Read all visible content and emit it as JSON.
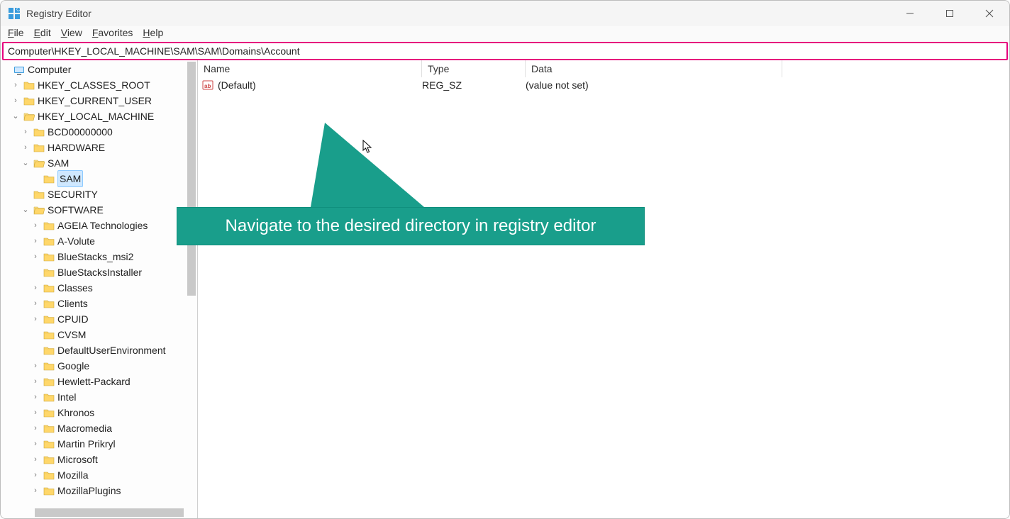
{
  "window": {
    "title": "Registry Editor"
  },
  "menu": {
    "file": "File",
    "edit": "Edit",
    "view": "View",
    "favorites": "Favorites",
    "help": "Help"
  },
  "address": {
    "path": "Computer\\HKEY_LOCAL_MACHINE\\SAM\\SAM\\Domains\\Account"
  },
  "tree": {
    "root": "Computer",
    "hkcr": "HKEY_CLASSES_ROOT",
    "hkcu": "HKEY_CURRENT_USER",
    "hklm": "HKEY_LOCAL_MACHINE",
    "hklm_children": {
      "bcd": "BCD00000000",
      "hardware": "HARDWARE",
      "sam": "SAM",
      "sam_child": "SAM",
      "security": "SECURITY",
      "software": "SOFTWARE",
      "software_children": [
        "AGEIA Technologies",
        "A-Volute",
        "BlueStacks_msi2",
        "BlueStacksInstaller",
        "Classes",
        "Clients",
        "CPUID",
        "CVSM",
        "DefaultUserEnvironment",
        "Google",
        "Hewlett-Packard",
        "Intel",
        "Khronos",
        "Macromedia",
        "Martin Prikryl",
        "Microsoft",
        "Mozilla",
        "MozillaPlugins"
      ]
    }
  },
  "list": {
    "headers": {
      "name": "Name",
      "type": "Type",
      "data": "Data"
    },
    "rows": [
      {
        "name": "(Default)",
        "type": "REG_SZ",
        "data": "(value not set)"
      }
    ]
  },
  "callout": {
    "text": "Navigate to the desired directory in registry editor"
  }
}
